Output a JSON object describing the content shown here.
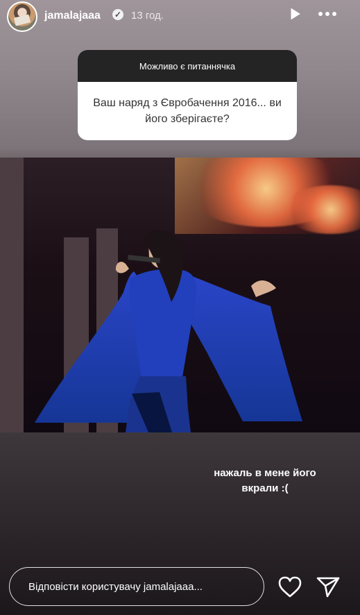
{
  "story": {
    "username": "jamalajaaa",
    "verified_badge": "✓",
    "time": "13 год.",
    "controls": {
      "play_icon": "play-icon",
      "more_icon": "more-icon"
    }
  },
  "question": {
    "title": "Можливо є питаннячка",
    "text": "Ваш наряд з Євробачення 2016... ви його зберігаєте?"
  },
  "caption": "нажаль в мене його вкрали :(",
  "reply": {
    "placeholder": "Відповісти користувачу jamalajaaa...",
    "heart_icon": "heart-icon",
    "send_icon": "send-icon"
  }
}
